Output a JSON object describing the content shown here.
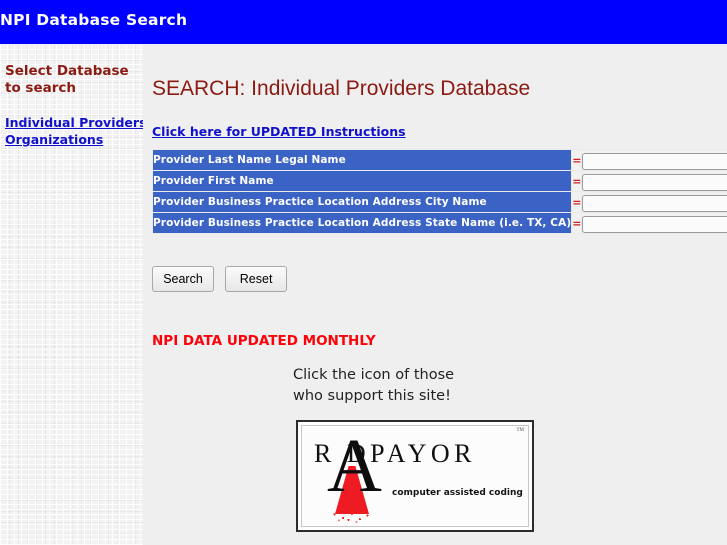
{
  "header": {
    "title": "NPI Database Search",
    "bar_color": "#0000ff"
  },
  "sidebar": {
    "heading": "Select Database to search",
    "links": [
      {
        "label": "Individual Providers"
      },
      {
        "label": "Organizations"
      }
    ],
    "link_color": "#1111cc",
    "heading_color": "#8b1a12"
  },
  "main": {
    "page_title": "SEARCH: Individual Providers Database",
    "instructions_link": "Click here for UPDATED Instructions",
    "update_notice": "NPI DATA UPDATED MONTHLY",
    "notice_color": "#fd0008",
    "support_text_line1": "Click the icon of those",
    "support_text_line2": "who support this site!"
  },
  "search_form": {
    "operator": "=",
    "label_bg": "#3b63c6",
    "fields": [
      {
        "label": "Provider Last Name Legal Name",
        "value": "",
        "placeholder": ""
      },
      {
        "label": "Provider First Name",
        "value": "",
        "placeholder": ""
      },
      {
        "label": "Provider Business Practice Location Address City Name",
        "value": "",
        "placeholder": ""
      },
      {
        "label": "Provider Business Practice Location Address State Name (i.e. TX, CA)",
        "value": "",
        "placeholder": ""
      }
    ],
    "buttons": {
      "search": "Search",
      "reset": "Reset"
    }
  },
  "sponsor": {
    "wordmark": "R    DPAYOR",
    "big_letter": "A",
    "tagline": "computer assisted coding",
    "tm": "TM",
    "accent_color": "#ee1b22"
  }
}
